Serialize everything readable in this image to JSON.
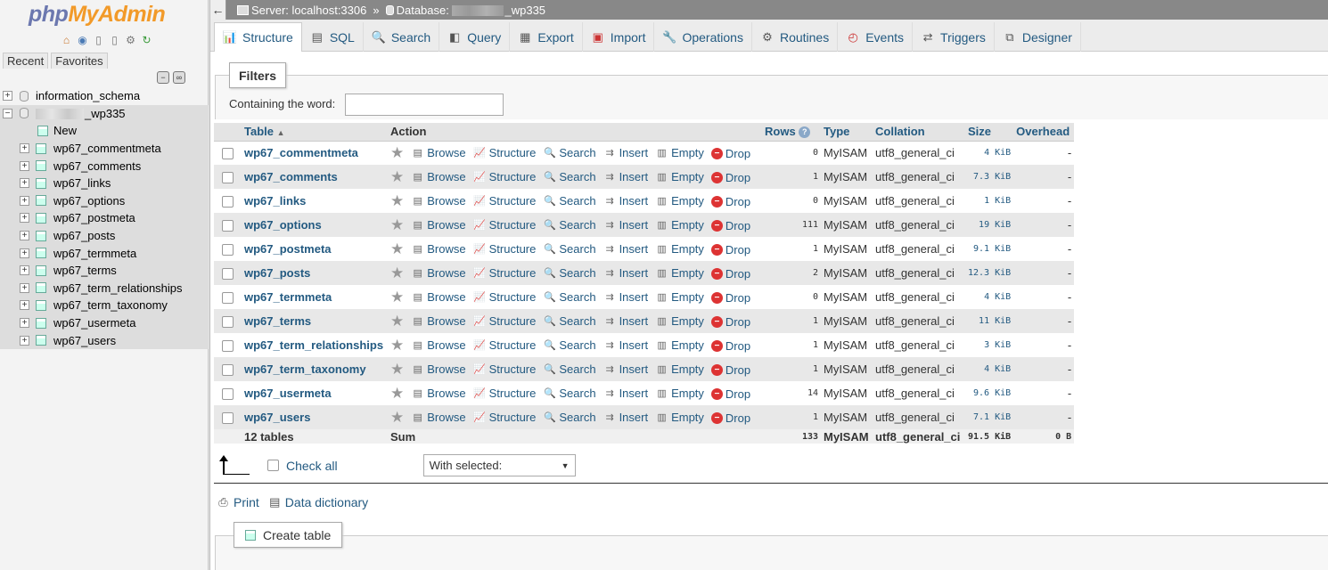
{
  "nav": {
    "logo_php": "php",
    "logo_myadmin": "MyAdmin",
    "recent": "Recent",
    "favorites": "Favorites",
    "dbs": [
      {
        "name": "information_schema"
      },
      {
        "name": "_wp335"
      }
    ],
    "new_label": "New",
    "tables": [
      "wp67_commentmeta",
      "wp67_comments",
      "wp67_links",
      "wp67_options",
      "wp67_postmeta",
      "wp67_posts",
      "wp67_termmeta",
      "wp67_terms",
      "wp67_term_relationships",
      "wp67_term_taxonomy",
      "wp67_usermeta",
      "wp67_users"
    ]
  },
  "topbar": {
    "server": "Server: localhost:3306",
    "sep": "»",
    "database_prefix": "Database:",
    "database_suffix": "_wp335"
  },
  "tabs": [
    "Structure",
    "SQL",
    "Search",
    "Query",
    "Export",
    "Import",
    "Operations",
    "Routines",
    "Events",
    "Triggers",
    "Designer"
  ],
  "filters": {
    "legend": "Filters",
    "label": "Containing the word:",
    "value": ""
  },
  "table": {
    "headers": {
      "table": "Table",
      "action": "Action",
      "rows": "Rows",
      "type": "Type",
      "collation": "Collation",
      "size": "Size",
      "overhead": "Overhead"
    },
    "actions": {
      "browse": "Browse",
      "structure": "Structure",
      "search": "Search",
      "insert": "Insert",
      "empty": "Empty",
      "drop": "Drop"
    },
    "rows": [
      {
        "name": "wp67_commentmeta",
        "rows": "0",
        "type": "MyISAM",
        "collation": "utf8_general_ci",
        "size": "4 KiB",
        "overhead": "-"
      },
      {
        "name": "wp67_comments",
        "rows": "1",
        "type": "MyISAM",
        "collation": "utf8_general_ci",
        "size": "7.3 KiB",
        "overhead": "-"
      },
      {
        "name": "wp67_links",
        "rows": "0",
        "type": "MyISAM",
        "collation": "utf8_general_ci",
        "size": "1 KiB",
        "overhead": "-"
      },
      {
        "name": "wp67_options",
        "rows": "111",
        "type": "MyISAM",
        "collation": "utf8_general_ci",
        "size": "19 KiB",
        "overhead": "-"
      },
      {
        "name": "wp67_postmeta",
        "rows": "1",
        "type": "MyISAM",
        "collation": "utf8_general_ci",
        "size": "9.1 KiB",
        "overhead": "-"
      },
      {
        "name": "wp67_posts",
        "rows": "2",
        "type": "MyISAM",
        "collation": "utf8_general_ci",
        "size": "12.3 KiB",
        "overhead": "-"
      },
      {
        "name": "wp67_termmeta",
        "rows": "0",
        "type": "MyISAM",
        "collation": "utf8_general_ci",
        "size": "4 KiB",
        "overhead": "-"
      },
      {
        "name": "wp67_terms",
        "rows": "1",
        "type": "MyISAM",
        "collation": "utf8_general_ci",
        "size": "11 KiB",
        "overhead": "-"
      },
      {
        "name": "wp67_term_relationships",
        "rows": "1",
        "type": "MyISAM",
        "collation": "utf8_general_ci",
        "size": "3 KiB",
        "overhead": "-"
      },
      {
        "name": "wp67_term_taxonomy",
        "rows": "1",
        "type": "MyISAM",
        "collation": "utf8_general_ci",
        "size": "4 KiB",
        "overhead": "-"
      },
      {
        "name": "wp67_usermeta",
        "rows": "14",
        "type": "MyISAM",
        "collation": "utf8_general_ci",
        "size": "9.6 KiB",
        "overhead": "-"
      },
      {
        "name": "wp67_users",
        "rows": "1",
        "type": "MyISAM",
        "collation": "utf8_general_ci",
        "size": "7.1 KiB",
        "overhead": "-"
      }
    ],
    "summary": {
      "tables": "12 tables",
      "sum": "Sum",
      "rows": "133",
      "type": "MyISAM",
      "collation": "utf8_general_ci",
      "size": "91.5 KiB",
      "overhead": "0 B"
    }
  },
  "bottom": {
    "check_all": "Check all",
    "with_selected": "With selected:",
    "print": "Print",
    "data_dictionary": "Data dictionary",
    "create_table": "Create table"
  }
}
